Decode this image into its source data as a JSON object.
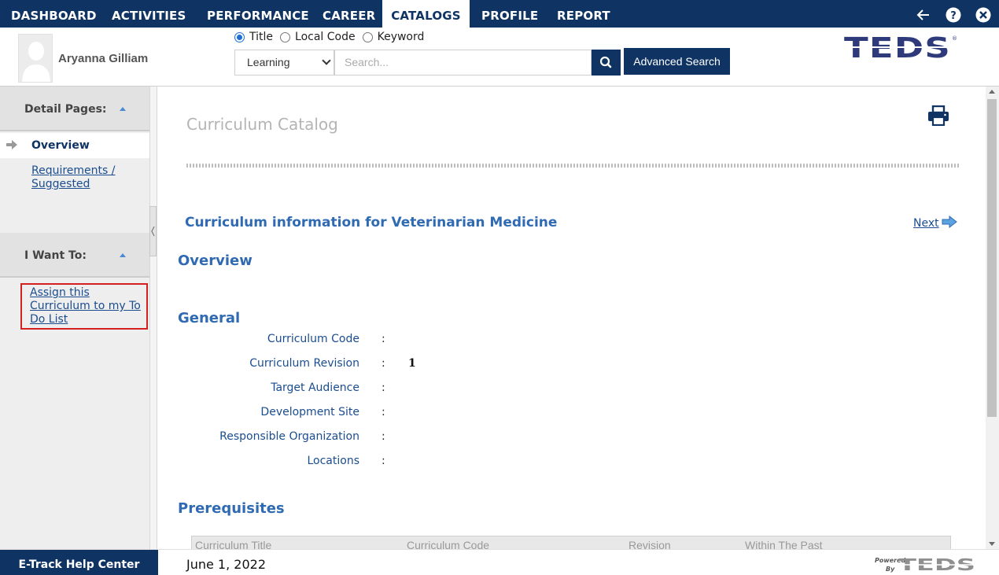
{
  "nav": {
    "items": [
      "DASHBOARD",
      "ACTIVITIES",
      "PERFORMANCE",
      "CAREER",
      "CATALOGS",
      "PROFILE",
      "REPORT"
    ],
    "active": "CATALOGS",
    "icons": [
      "back-arrow-icon",
      "help-icon",
      "close-icon"
    ]
  },
  "user": {
    "name": "Aryanna Gilliam"
  },
  "search": {
    "radios": [
      "Title",
      "Local Code",
      "Keyword"
    ],
    "selected_radio": "Title",
    "category": "Learning",
    "placeholder": "Search...",
    "advanced_label": "Advanced Search"
  },
  "brand": {
    "logo_text": "TEDS",
    "accent": "#2e3a7a"
  },
  "sidebar": {
    "detail_heading": "Detail Pages:",
    "overview": "Overview",
    "requirements": "Requirements / Suggested",
    "want_heading": "I Want To:",
    "assign": "Assign this Curriculum to my To Do List"
  },
  "main": {
    "page_title": "Curriculum Catalog",
    "curriculum_info": "Curriculum information for Veterinarian Medicine",
    "next_label": "Next",
    "overview_heading": "Overview",
    "general_heading": "General",
    "fields": [
      {
        "label": "Curriculum Code",
        "value": ""
      },
      {
        "label": "Curriculum Revision",
        "value": "1"
      },
      {
        "label": "Target Audience",
        "value": ""
      },
      {
        "label": "Development Site",
        "value": ""
      },
      {
        "label": "Responsible Organization",
        "value": ""
      },
      {
        "label": "Locations",
        "value": ""
      }
    ],
    "prereq_heading": "Prerequisites",
    "prereq_columns": [
      "Curriculum Title",
      "Curriculum Code",
      "Revision",
      "Within The Past"
    ]
  },
  "footer": {
    "help_center": "E-Track Help Center",
    "date": "June 1, 2022",
    "powered_by": "Powered By",
    "powered_brand": "TEDS"
  },
  "colors": {
    "navy": "#0f3463",
    "link": "#1a4d8f",
    "heading_blue": "#2f6ab3"
  }
}
